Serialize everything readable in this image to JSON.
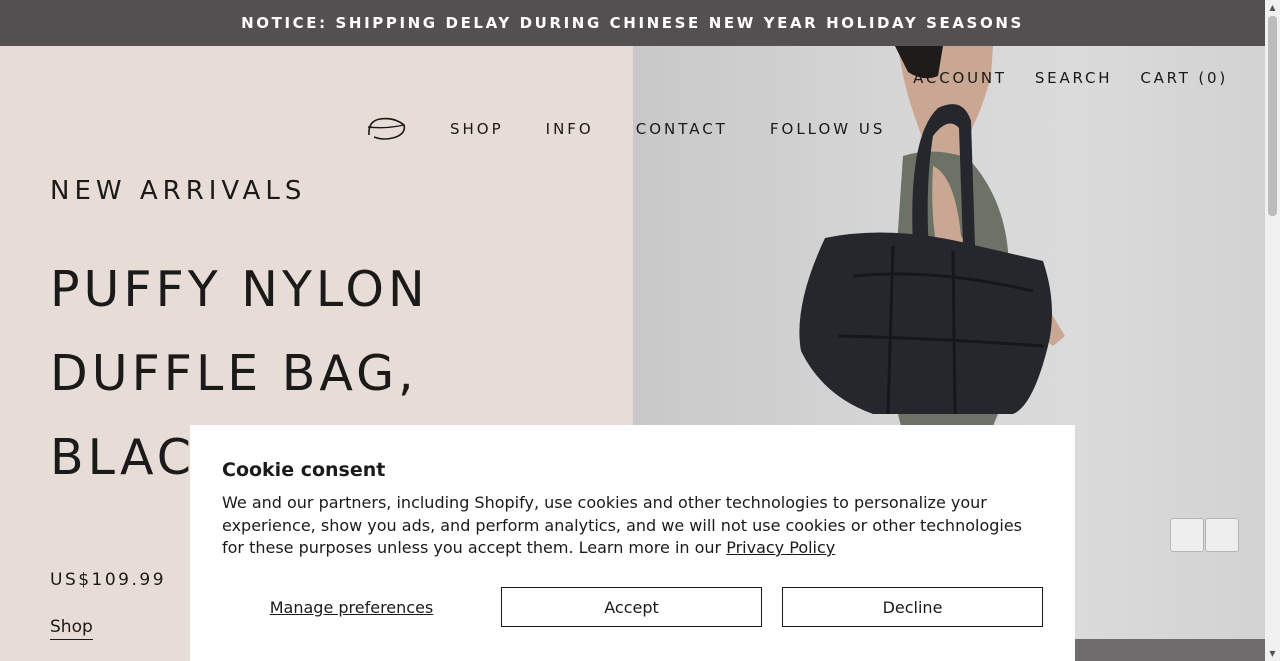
{
  "notice": {
    "text": "NOTICE: SHIPPING DELAY DURING CHINESE NEW YEAR HOLIDAY SEASONS"
  },
  "header": {
    "top_links": [
      "ACCOUNT",
      "SEARCH",
      "CART (0)"
    ],
    "nav": [
      "SHOP",
      "INFO",
      "CONTACT",
      "FOLLOW US"
    ]
  },
  "hero": {
    "kicker": "NEW ARRIVALS",
    "title_lines": [
      "PUFFY NYLON",
      "DUFFLE BAG,",
      "BLACK"
    ],
    "price": "US$109.99",
    "cta": "Shop"
  },
  "cookie": {
    "title": "Cookie consent",
    "body": "We and our partners, including Shopify, use cookies and other technologies to personalize your experience, show you ads, and perform analytics, and we will not use cookies or other technologies for these purposes unless you accept them. Learn more in our ",
    "link": "Privacy Policy",
    "manage": "Manage preferences",
    "accept": "Accept",
    "decline": "Decline"
  },
  "colors": {
    "notice_bg": "#545051",
    "hero_left_bg": "#e8dcd6",
    "bag": "#25272c"
  }
}
